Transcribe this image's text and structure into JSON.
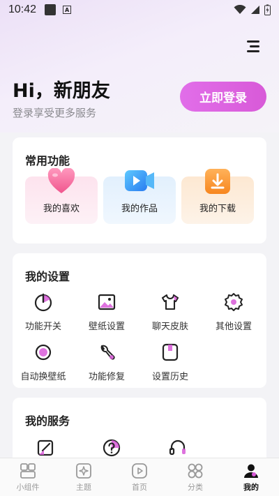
{
  "status_bar": {
    "time": "10:42",
    "a_badge": "A"
  },
  "header": {
    "greeting": "Hi，新朋友",
    "subtitle": "登录享受更多服务",
    "login_label": "立即登录"
  },
  "common": {
    "title": "常用功能",
    "items": [
      {
        "label": "我的喜欢",
        "icon": "heart-icon"
      },
      {
        "label": "我的作品",
        "icon": "video-icon"
      },
      {
        "label": "我的下载",
        "icon": "download-icon"
      }
    ]
  },
  "settings": {
    "title": "我的设置",
    "items": [
      {
        "label": "功能开关",
        "icon": "power-icon"
      },
      {
        "label": "壁纸设置",
        "icon": "image-icon"
      },
      {
        "label": "聊天皮肤",
        "icon": "shirt-icon"
      },
      {
        "label": "其他设置",
        "icon": "gear-icon"
      },
      {
        "label": "自动换壁纸",
        "icon": "refresh-icon"
      },
      {
        "label": "功能修复",
        "icon": "wrench-icon"
      },
      {
        "label": "设置历史",
        "icon": "history-icon"
      }
    ]
  },
  "services": {
    "title": "我的服务",
    "items": [
      {
        "icon": "edit-icon"
      },
      {
        "icon": "help-icon"
      },
      {
        "icon": "headset-icon"
      }
    ]
  },
  "tabbar": {
    "items": [
      {
        "label": "小组件",
        "icon": "widgets-icon"
      },
      {
        "label": "主题",
        "icon": "theme-icon"
      },
      {
        "label": "首页",
        "icon": "play-icon"
      },
      {
        "label": "分类",
        "icon": "category-icon"
      },
      {
        "label": "我的",
        "icon": "person-icon"
      }
    ],
    "active_index": 4
  },
  "colors": {
    "accent": "#d85ad8",
    "accent_light": "#e16ee9",
    "tile_pink": "#fdeef5",
    "tile_blue": "#eaf4fd",
    "tile_orange": "#fdf1e4"
  }
}
